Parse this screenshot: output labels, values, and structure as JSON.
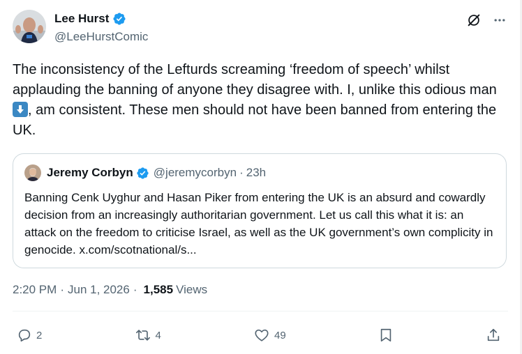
{
  "author": {
    "display_name": "Lee Hurst",
    "handle": "@LeeHurstComic",
    "verified_icon": "verified-badge-icon"
  },
  "header_actions": {
    "grok_icon": "grok-icon",
    "more_icon": "more-options-icon"
  },
  "tweet": {
    "text_part1": "The inconsistency of the Lefturds screaming ‘freedom of speech’ whilst applauding the banning of anyone they disagree with. I, unlike this odious man ",
    "text_part2": ", am consistent. These men should not have been banned from entering the UK.",
    "emoji": "down-arrow-emoji"
  },
  "quote": {
    "display_name": "Jeremy Corbyn",
    "handle": "@jeremycorbyn",
    "separator": "·",
    "time": "23h",
    "text": "Banning Cenk Uyghur and Hasan Piker from entering the UK is an absurd and cowardly decision from an increasingly authoritarian government. Let us call this what it is: an attack on the freedom to criticise Israel, as well as the UK government’s own complicity in genocide. x.com/scotnational/s..."
  },
  "meta": {
    "time": "2:20 PM",
    "sep1": "·",
    "date": "Jun 1, 2026",
    "sep2": "·",
    "views_count": "1,585",
    "views_label": "Views"
  },
  "actions": {
    "replies": "2",
    "reposts": "4",
    "likes": "49",
    "bookmark_icon": "bookmark-icon",
    "share_icon": "share-icon"
  },
  "colors": {
    "verified": "#1d9bf0",
    "text": "#0f1419",
    "secondary": "#536471",
    "border": "#cfd9de",
    "emoji_bg": "#3b88c3"
  }
}
